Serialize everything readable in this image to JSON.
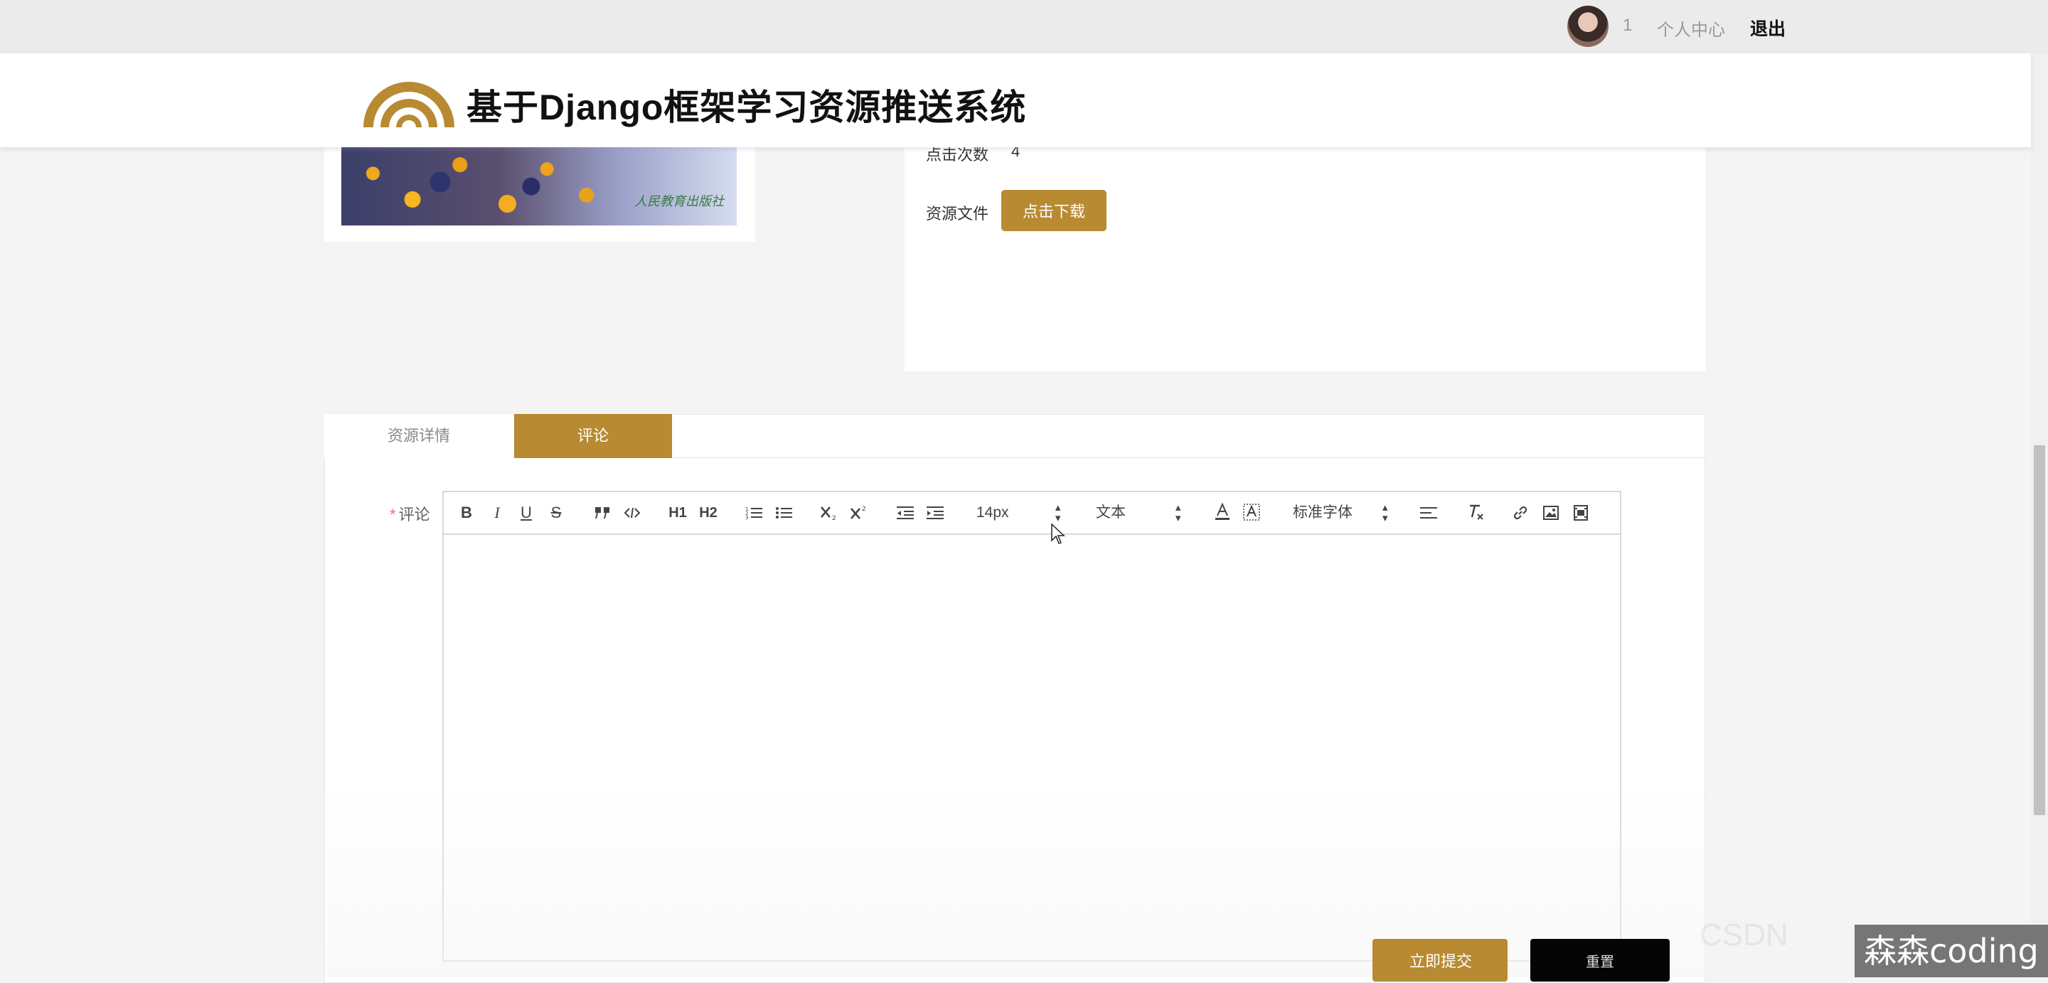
{
  "topbar": {
    "user_id": "1",
    "user_center": "个人中心",
    "logout": "退出"
  },
  "header": {
    "title": "基于Django框架学习资源推送系统",
    "logo_icon": "arch-logo-icon",
    "brand_color": "#b88a32"
  },
  "resource": {
    "cover_stamp": "人民教育出版社",
    "click_label": "点击次数",
    "click_value": "4",
    "file_label": "资源文件",
    "download_label": "点击下载"
  },
  "tabs": [
    {
      "label": "资源详情",
      "active": false
    },
    {
      "label": "评论",
      "active": true
    }
  ],
  "comment": {
    "required_mark": "*",
    "label": "评论",
    "toolbar": {
      "bold": "B",
      "italic": "I",
      "underline": "U",
      "strike": "S",
      "h1": "H1",
      "h2": "H2",
      "font_size": "14px",
      "text_style": "文本",
      "font_family": "标准字体"
    },
    "submit_label": "立即提交",
    "reset_label": "重置"
  },
  "watermark": "森森coding"
}
